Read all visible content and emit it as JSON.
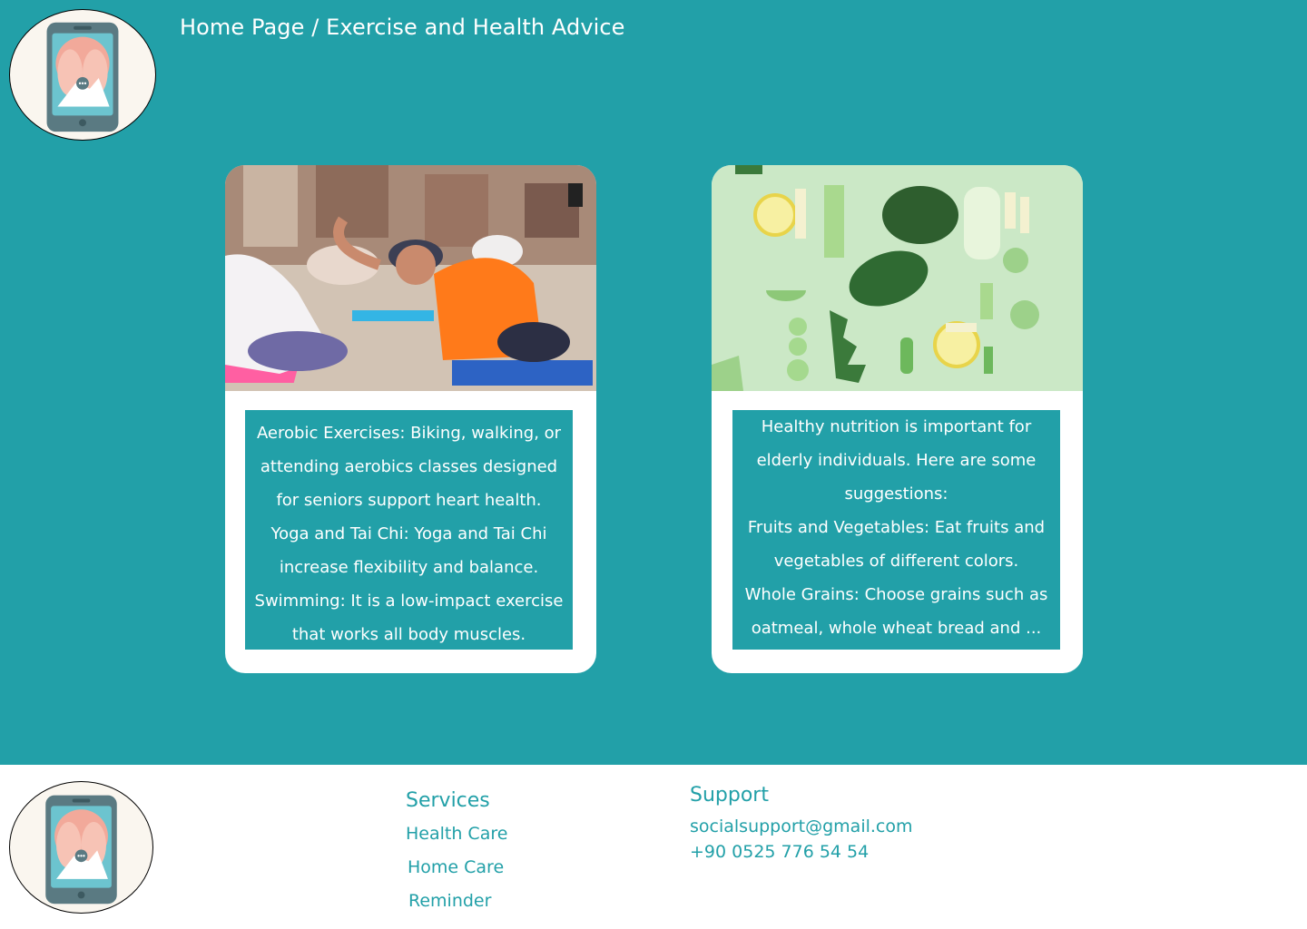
{
  "header": {
    "breadcrumb_home": "Home Page",
    "breadcrumb_separator": " / ",
    "breadcrumb_current": "Exercise and Health Advice"
  },
  "cards": [
    {
      "image_subject": "group yoga class on mats",
      "lines": [
        "Aerobic Exercises: Biking, walking, or",
        "attending aerobics classes designed",
        "for seniors support heart health.",
        "Yoga and Tai Chi: Yoga and Tai Chi",
        "increase flexibility and balance.",
        "Swimming: It is a low-impact exercise",
        "that works all body muscles."
      ]
    },
    {
      "image_subject": "sliced vegetables, lemons and spinach on green background",
      "lines": [
        "Healthy nutrition is important for",
        "elderly individuals. Here are some",
        "suggestions:",
        "Fruits and Vegetables: Eat fruits and",
        "vegetables of different colors.",
        "Whole Grains: Choose grains such as",
        "oatmeal, whole wheat bread and ..."
      ]
    }
  ],
  "footer": {
    "services_title": "Services",
    "services": [
      "Health Care",
      "Home Care",
      "Reminder"
    ],
    "support_title": "Support",
    "email": "socialsupport@gmail.com",
    "phone": "+90 0525 776 54 54"
  },
  "colors": {
    "accent": "#22a0a8",
    "text_on_accent": "#ffffff"
  },
  "icons": {
    "logo": "phone-caregiver-logo-icon"
  }
}
